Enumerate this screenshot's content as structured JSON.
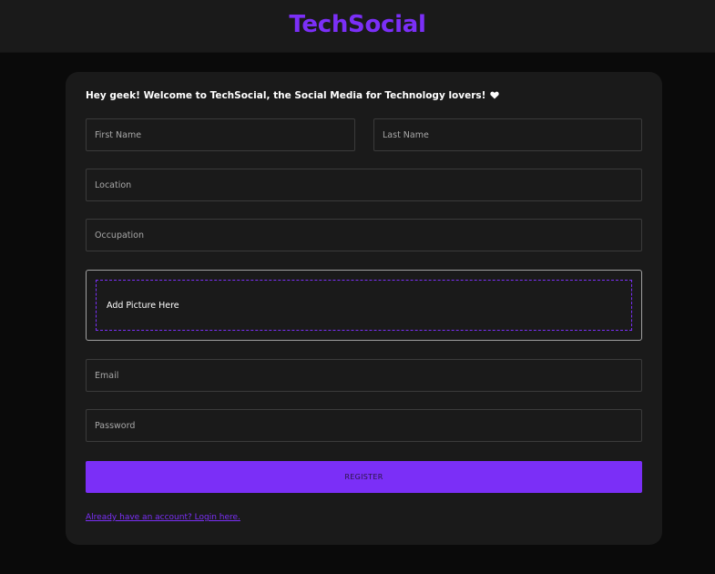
{
  "header": {
    "brand": "TechSocial"
  },
  "form": {
    "welcome": "Hey geek! Welcome to TechSocial, the Social Media for Technology lovers!",
    "first_name_placeholder": "First Name",
    "last_name_placeholder": "Last Name",
    "location_placeholder": "Location",
    "occupation_placeholder": "Occupation",
    "picture_label": "Add Picture Here",
    "email_placeholder": "Email",
    "password_placeholder": "Password",
    "register_label": "REGISTER",
    "login_link": "Already have an account? Login here."
  },
  "colors": {
    "accent": "#7b2ff7",
    "page_background": "#0a0a0a",
    "card_background": "#1a1a1a"
  },
  "icons": {
    "welcome_icon": "heart-icon"
  }
}
